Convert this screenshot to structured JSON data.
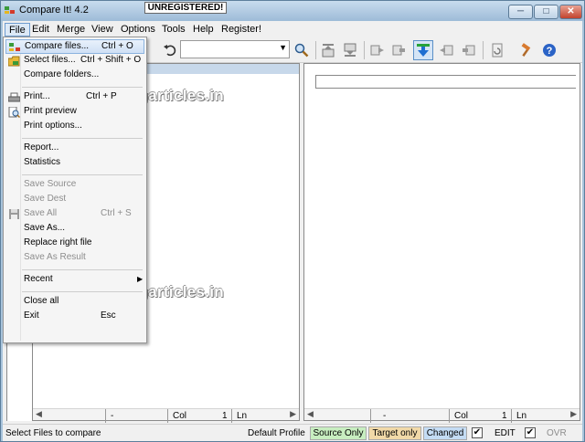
{
  "window": {
    "title": "Compare It! 4.2",
    "unregistered_label": "UNREGISTERED!",
    "controls": {
      "minimize": "─",
      "maximize": "□",
      "close": "✕"
    }
  },
  "menubar": {
    "items": [
      "File",
      "Edit",
      "Merge",
      "View",
      "Options",
      "Tools",
      "Help",
      "Register!"
    ],
    "active": "File"
  },
  "toolbar": {
    "combo_value": ""
  },
  "file_menu": {
    "compare_files": {
      "label": "Compare files...",
      "shortcut": "Ctrl + O"
    },
    "select_files": {
      "label": "Select files...",
      "shortcut": "Ctrl + Shift + O"
    },
    "compare_folders": {
      "label": "Compare folders..."
    },
    "print": {
      "label": "Print...",
      "shortcut": "Ctrl + P"
    },
    "print_preview": {
      "label": "Print preview"
    },
    "print_options": {
      "label": "Print options..."
    },
    "report": {
      "label": "Report..."
    },
    "statistics": {
      "label": "Statistics"
    },
    "save_source": {
      "label": "Save Source"
    },
    "save_dest": {
      "label": "Save Dest"
    },
    "save_all": {
      "label": "Save All",
      "shortcut": "Ctrl + S"
    },
    "save_as": {
      "label": "Save As..."
    },
    "replace_right": {
      "label": "Replace right file"
    },
    "save_as_result": {
      "label": "Save As Result"
    },
    "recent": {
      "label": "Recent"
    },
    "close_all": {
      "label": "Close all"
    },
    "exit": {
      "label": "Exit",
      "shortcut": "Esc"
    }
  },
  "watermark": "www.hackingarticles.in",
  "left_pane_status": {
    "dash": "-",
    "col_label": "Col",
    "col_value": "1",
    "ln_label": "Ln"
  },
  "right_pane_status": {
    "dash": "-",
    "col_label": "Col",
    "col_value": "1",
    "ln_label": "Ln"
  },
  "statusbar": {
    "message": "Select Files to compare",
    "profile": "Default Profile",
    "source_only": "Source Only",
    "target_only": "Target only",
    "changed": "Changed",
    "edit_label": "EDIT",
    "ovr_label": "OVR",
    "edit_checked": "✔",
    "ovr_checked": "✔"
  },
  "colors": {
    "source_only_bg": "#c8eec0",
    "target_only_bg": "#f1d9a8",
    "changed_bg": "#c4dcf4",
    "pane_header": "#c7d8ea"
  }
}
